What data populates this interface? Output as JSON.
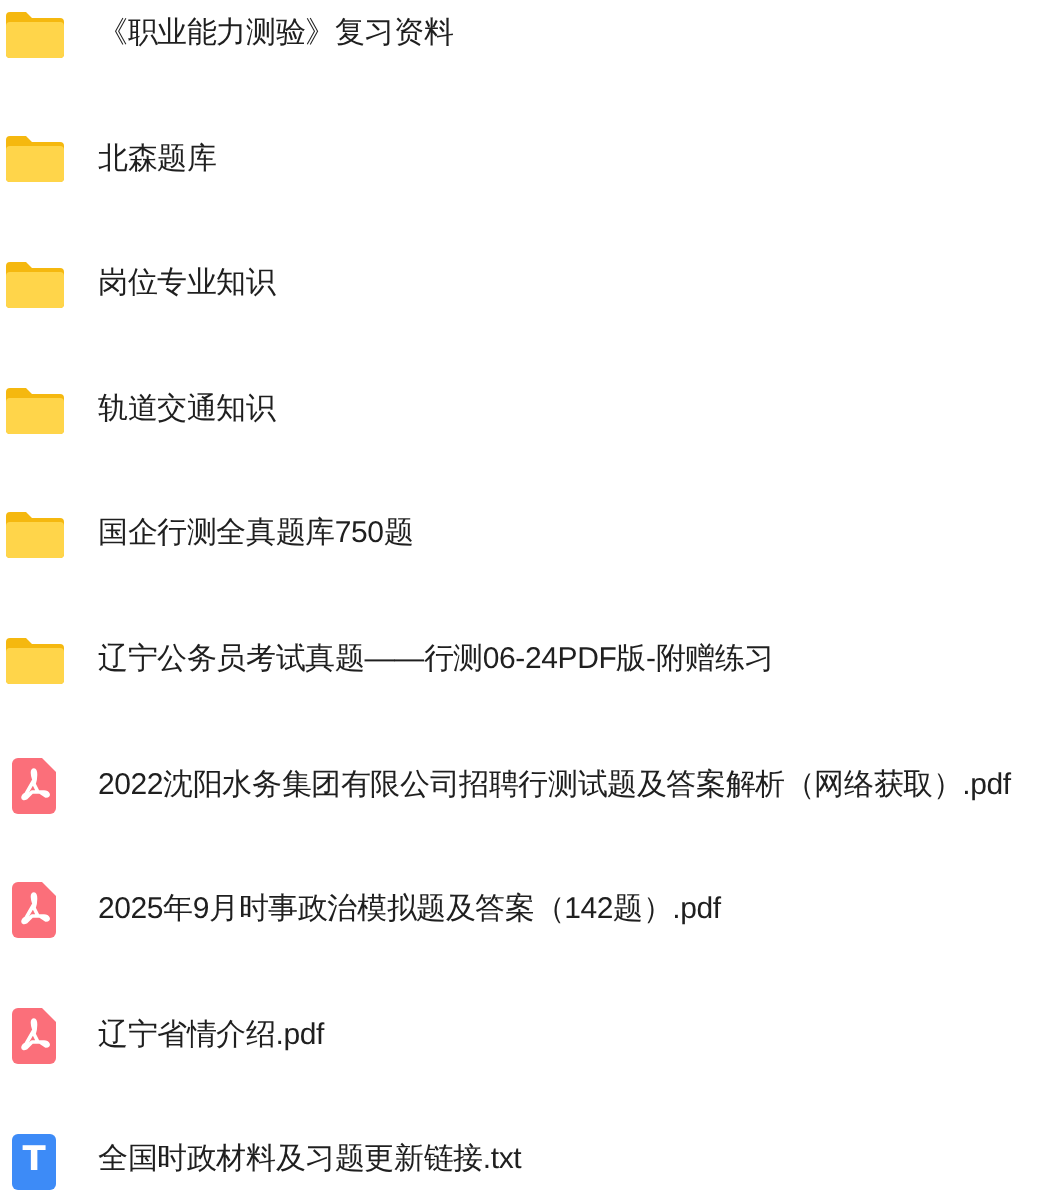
{
  "files": [
    {
      "kind": "folder",
      "name": "《职业能力测验》复习资料"
    },
    {
      "kind": "folder",
      "name": "北森题库"
    },
    {
      "kind": "folder",
      "name": "岗位专业知识"
    },
    {
      "kind": "folder",
      "name": "轨道交通知识"
    },
    {
      "kind": "folder",
      "name": "国企行测全真题库750题"
    },
    {
      "kind": "folder",
      "name": "辽宁公务员考试真题——行测06-24PDF版-附赠练习"
    },
    {
      "kind": "pdf",
      "name": "2022沈阳水务集团有限公司招聘行测试题及答案解析（网络获取）.pdf"
    },
    {
      "kind": "pdf",
      "name": "2025年9月时事政治模拟题及答案（142题）.pdf"
    },
    {
      "kind": "pdf",
      "name": "辽宁省情介绍.pdf"
    },
    {
      "kind": "txt",
      "name": "全国时政材料及习题更新链接.txt",
      "icon_letter": "T"
    }
  ]
}
